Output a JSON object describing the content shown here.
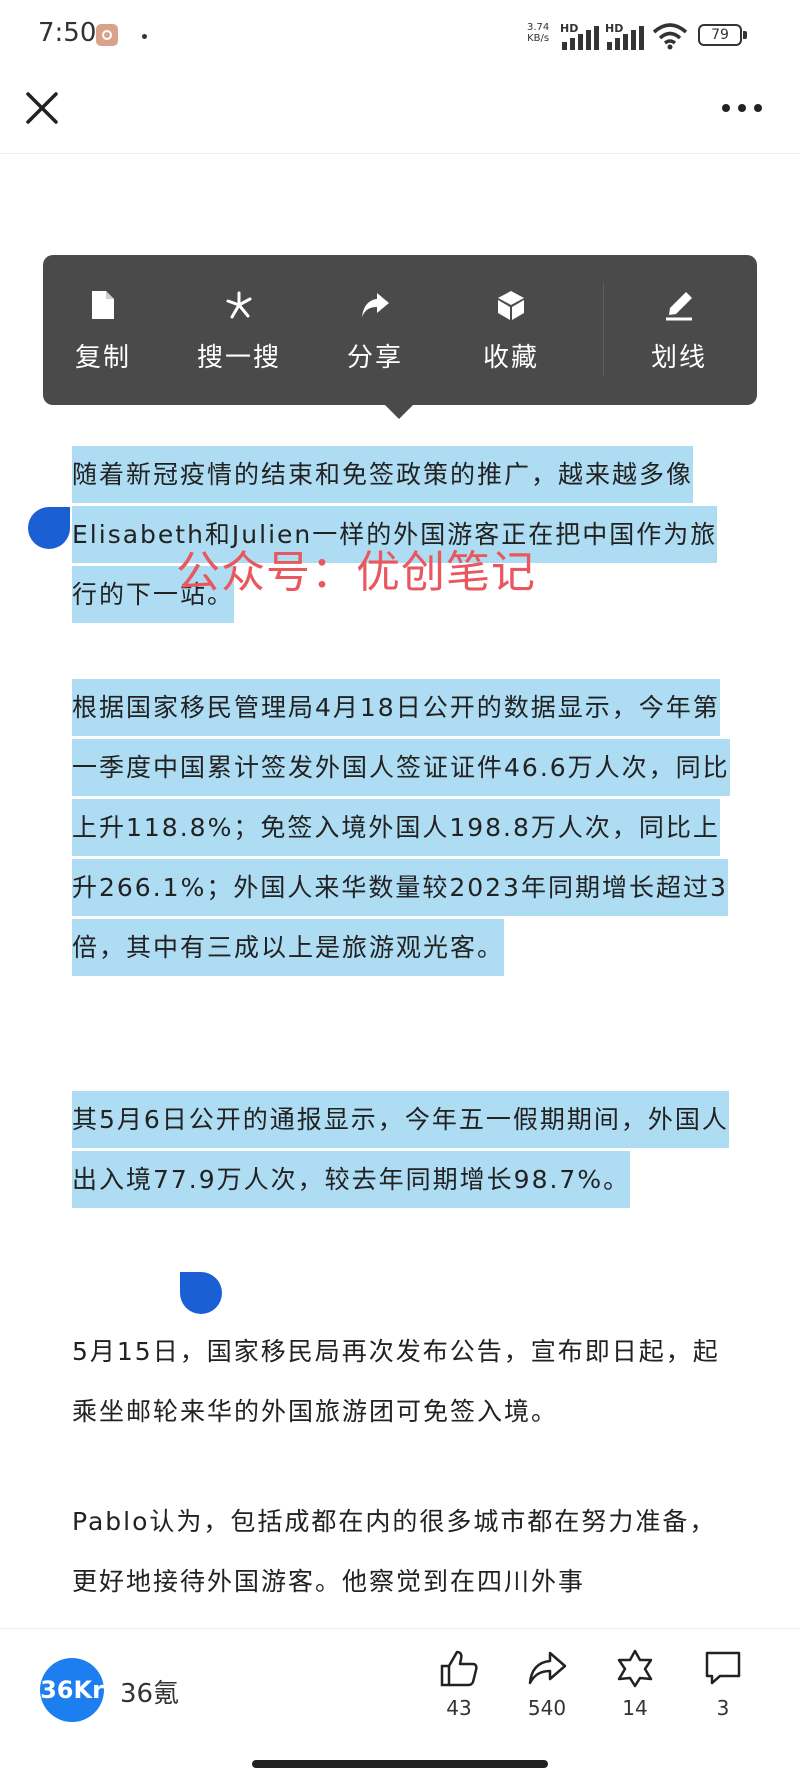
{
  "status_bar": {
    "time": "7:50",
    "net_speed_value": "3.74",
    "net_speed_unit": "KB/s",
    "signal1_label": "HD",
    "signal2_label": "HD",
    "battery": "79"
  },
  "context_menu": {
    "items": [
      {
        "label": "复制",
        "icon": "document-icon"
      },
      {
        "label": "搜一搜",
        "icon": "search-spark-icon"
      },
      {
        "label": "分享",
        "icon": "share-icon"
      },
      {
        "label": "收藏",
        "icon": "cube-icon"
      },
      {
        "label": "划线",
        "icon": "highlighter-pen-icon"
      }
    ]
  },
  "article": {
    "p1": "随着新冠疫情的结束和免签政策的推广，越来越多像Elisabeth和Julien一样的外国游客正在把中国作为旅行的下一站。",
    "p2": "根据国家移民管理局4月18日公开的数据显示，今年第一季度中国累计签发外国人签证证件46.6万人次，同比上升118.8%；免签入境外国人198.8万人次，同比上升266.1%；外国人来华数量较2023年同期增长超过3倍，其中有三成以上是旅游观光客。",
    "p3": "其5月6日公开的通报显示，今年五一假期期间，外国人出入境77.9万人次，较去年同期增长98.7%。",
    "p4": "5月15日，国家移民局再次发布公告，宣布即日起，起乘坐邮轮来华的外国旅游团可免签入境。",
    "p5": "Pablo认为，包括成都在内的很多城市都在努力准备，更好地接待外国游客。他察觉到在四川外事"
  },
  "watermark": "公众号：优创笔记",
  "footer": {
    "avatar_text": "36Kr",
    "author": "36氪",
    "likes": "43",
    "shares": "540",
    "favorites": "14",
    "comments": "3"
  },
  "colors": {
    "highlight": "#aedcf3",
    "menu_bg": "#4a4a4a",
    "handle": "#1a5fd4",
    "avatar": "#1d7ef0",
    "watermark": "#e8585e"
  }
}
